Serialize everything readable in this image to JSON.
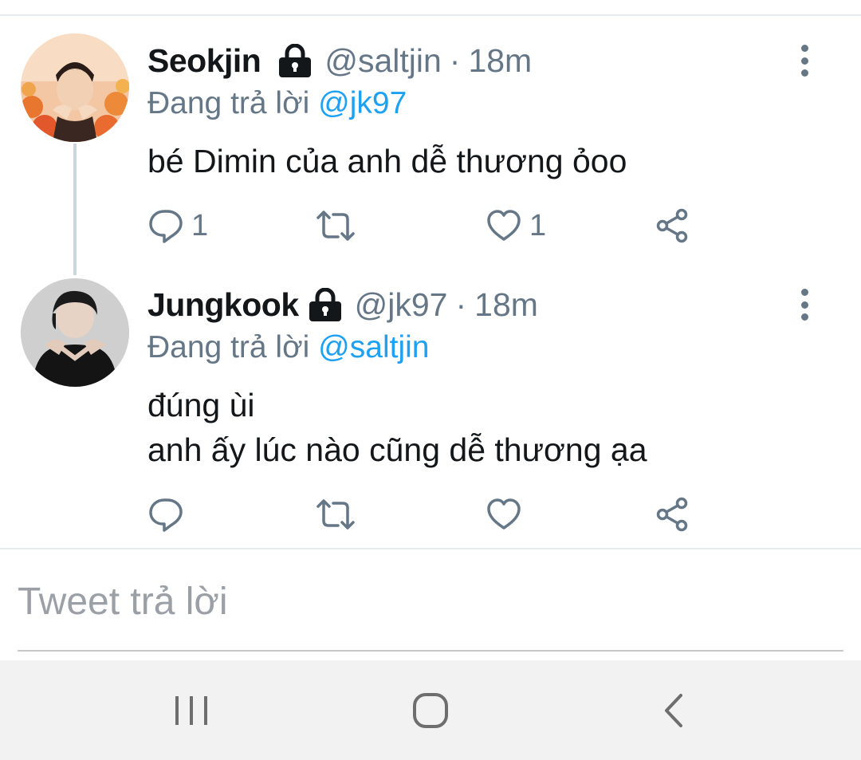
{
  "tweets": [
    {
      "display_name": "Seokjin",
      "handle": "@saltjin",
      "separator": "·",
      "time": "18m",
      "replying_prefix": "Đang trả lời",
      "replying_to": "@jk97",
      "text": "bé Dimin của anh dễ thương ỏoo",
      "reply_count": "1",
      "like_count": "1",
      "avatar_icon": "avatar-photo-seokjin"
    },
    {
      "display_name": "Jungkook",
      "handle": "@jk97",
      "separator": "·",
      "time": "18m",
      "replying_prefix": "Đang trả lời",
      "replying_to": "@saltjin",
      "text_lines": [
        "đúng ùi",
        "anh ấy lúc nào cũng dễ thương ạa"
      ],
      "avatar_icon": "avatar-photo-jungkook"
    }
  ],
  "reply_box": {
    "placeholder": "Tweet trả lời"
  },
  "icons": [
    "lock-icon",
    "more-vertical-icon",
    "reply-icon",
    "retweet-icon",
    "like-icon",
    "share-icon",
    "recents-icon",
    "home-icon",
    "back-icon"
  ],
  "colors": {
    "mention": "#1da1f2",
    "secondary_text": "#657786",
    "primary_text": "#14171a",
    "navbar": "#f2f2f2"
  }
}
